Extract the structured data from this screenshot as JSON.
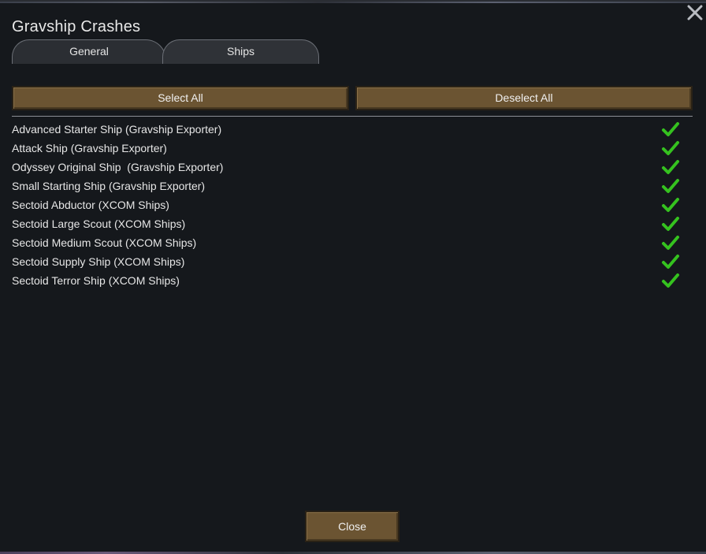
{
  "dialog": {
    "title": "Gravship Crashes"
  },
  "tabs": [
    {
      "label": "General",
      "active": false
    },
    {
      "label": "Ships",
      "active": true
    }
  ],
  "actions": {
    "select_all": "Select All",
    "deselect_all": "Deselect All"
  },
  "ships": [
    {
      "label": "Advanced Starter Ship (Gravship Exporter)",
      "checked": true
    },
    {
      "label": "Attack Ship (Gravship Exporter)",
      "checked": true
    },
    {
      "label": "Odyssey Original Ship  (Gravship Exporter)",
      "checked": true
    },
    {
      "label": "Small Starting Ship (Gravship Exporter)",
      "checked": true
    },
    {
      "label": "Sectoid Abductor (XCOM Ships)",
      "checked": true
    },
    {
      "label": "Sectoid Large Scout (XCOM Ships)",
      "checked": true
    },
    {
      "label": "Sectoid Medium Scout (XCOM Ships)",
      "checked": true
    },
    {
      "label": "Sectoid Supply Ship (XCOM Ships)",
      "checked": true
    },
    {
      "label": "Sectoid Terror Ship (XCOM Ships)",
      "checked": true
    }
  ],
  "footer": {
    "close_label": "Close"
  },
  "icons": {
    "close": "close-icon",
    "check": "checkmark-icon"
  },
  "colors": {
    "background": "#15181c",
    "button": "#6b5432",
    "check": "#35c21f",
    "text": "#e6e6e6"
  }
}
